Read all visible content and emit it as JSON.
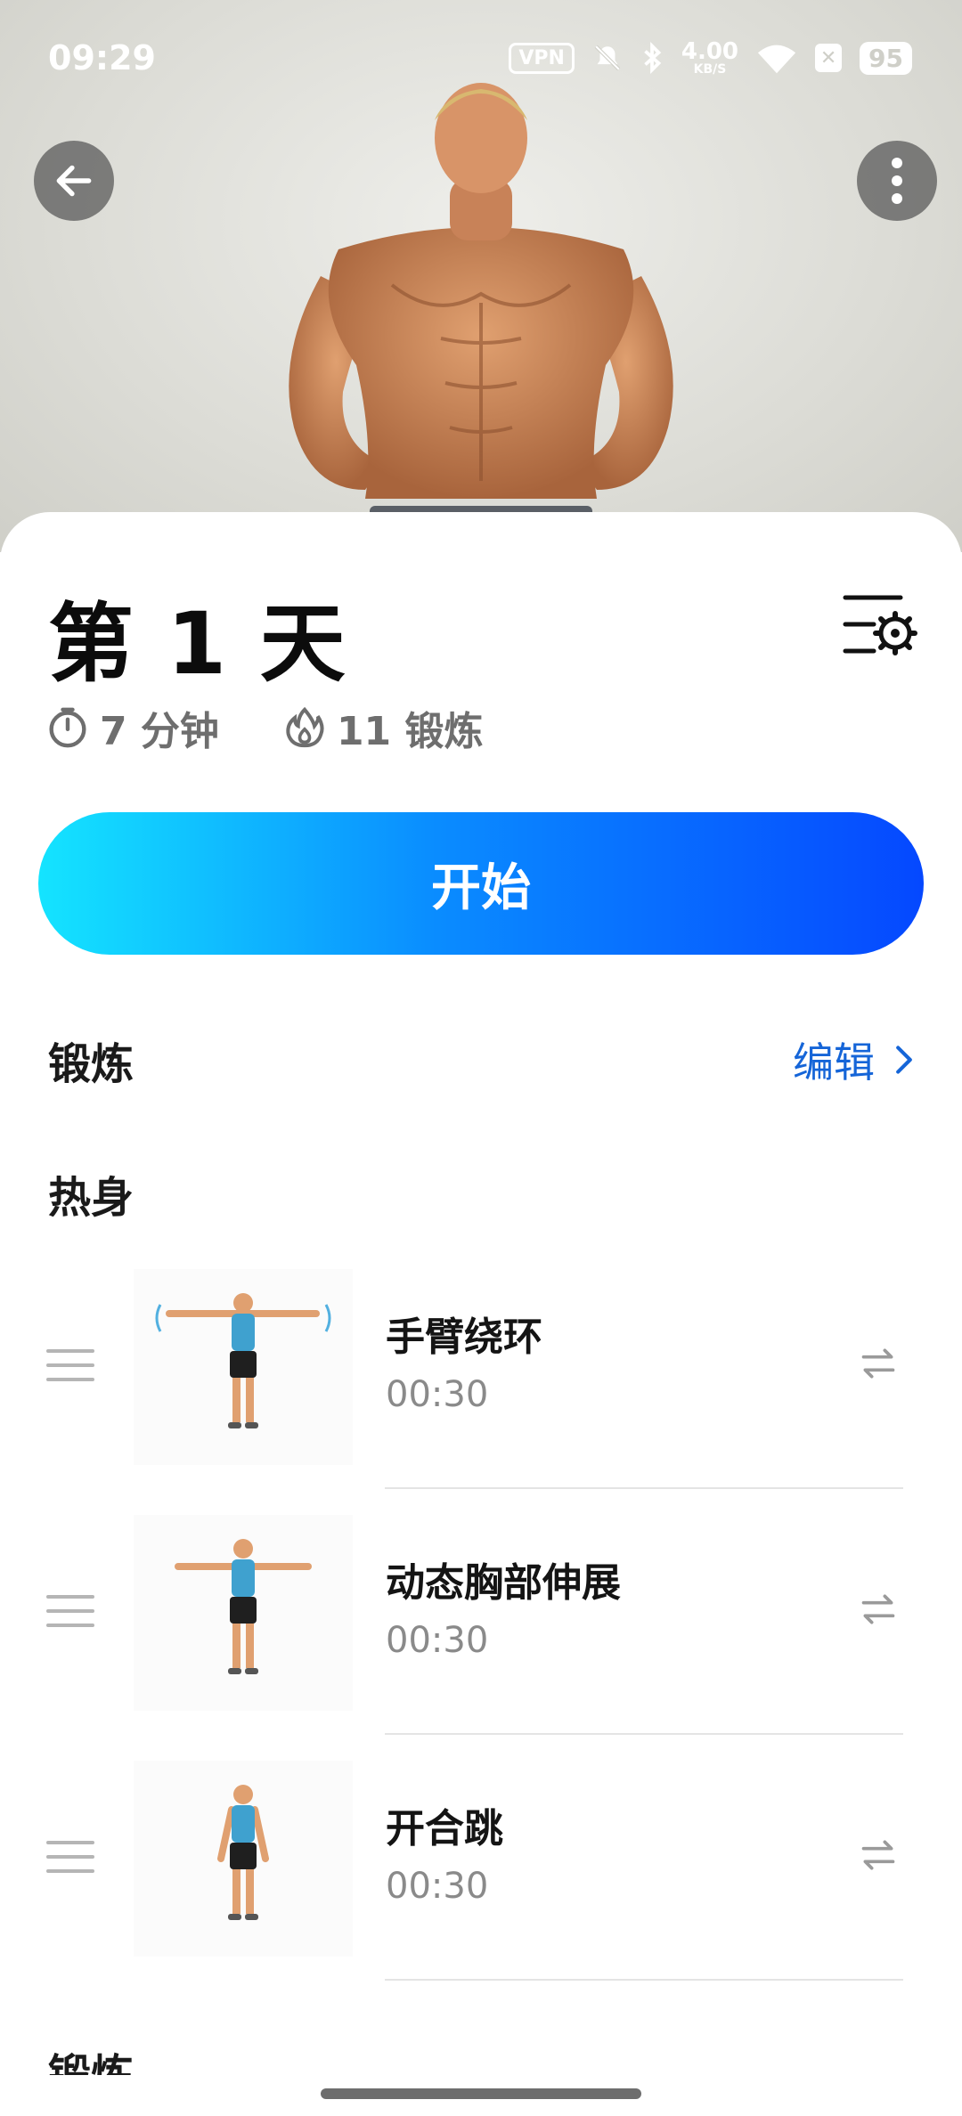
{
  "status_bar": {
    "time": "09:29",
    "vpn": "VPN",
    "speed_value": "4.00",
    "speed_unit": "KB/S",
    "battery": "95",
    "icons": [
      "vpn-icon",
      "mute-bell-icon",
      "bluetooth-icon",
      "wifi-icon",
      "x-box-icon",
      "battery-icon"
    ]
  },
  "hero": {
    "back_icon": "arrow-left-icon",
    "more_icon": "vertical-dots-icon"
  },
  "workout": {
    "title": "第 1 天",
    "duration": "7 分钟",
    "exercise_count": "11 锻炼",
    "start_label": "开始",
    "settings_icon": "list-settings-icon"
  },
  "section": {
    "title": "锻炼",
    "edit_label": "编辑"
  },
  "warmup": {
    "title": "热身",
    "items": [
      {
        "name": "手臂绕环",
        "time": "00:30"
      },
      {
        "name": "动态胸部伸展",
        "time": "00:30"
      },
      {
        "name": "开合跳",
        "time": "00:30"
      }
    ]
  },
  "next_section_title": "锻炼",
  "colors": {
    "accent_blue": "#1565d8",
    "gradient_start": "#14e4ff",
    "gradient_end": "#0548ff"
  }
}
